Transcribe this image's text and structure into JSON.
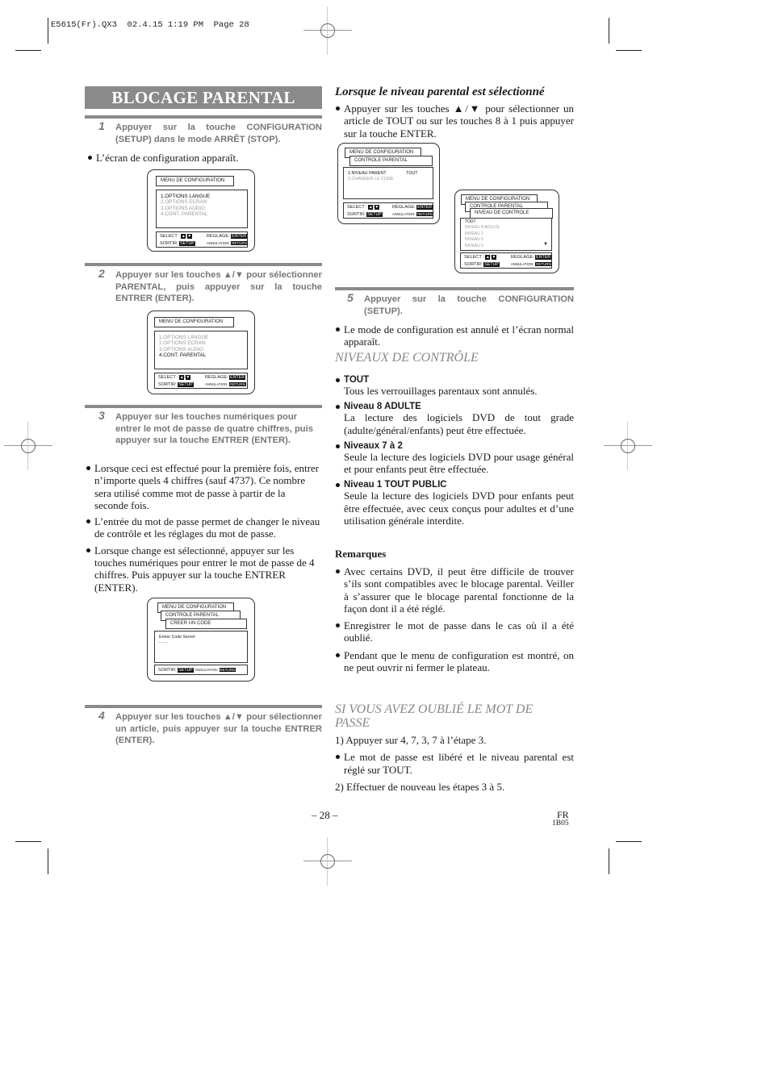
{
  "slug": "E5615(Fr).QX3  02.4.15 1:19 PM  Page 28",
  "title": "BLOCAGE PARENTAL",
  "left": {
    "step1": {
      "num": "1",
      "text": "Appuyer sur la touche CONFIGURATION (SETUP) dans le mode ARRÊT (STOP)."
    },
    "step1_bullet": "L’écran de configuration apparaît.",
    "screen1": {
      "header": "MENU DE CONFIGURATION",
      "items": [
        "1.OPTIONS LANGUE",
        "2.OPTIONS ECRAN",
        "3.OPTIONS AUDIO",
        "4.CONT. PARENTAL"
      ],
      "selected_index": 0
    },
    "step2": {
      "num": "2",
      "text": "Appuyer sur les touches ▲/▼ pour sélectionner PARENTAL, puis appuyer sur la touche ENTRER (ENTER)."
    },
    "screen2": {
      "header": "MENU DE CONFIGURATION",
      "items": [
        "1.OPTIONS LANGUE",
        "2.OPTIONS ECRAN",
        "3.OPTIONS AUDIO",
        "4.CONT. PARENTAL"
      ],
      "selected_index": 3
    },
    "step3": {
      "num": "3",
      "text": "Appuyer sur les touches numériques pour entrer le mot de passe de quatre chiffres, puis appuyer sur la touche ENTRER (ENTER)."
    },
    "step3_bullets": [
      "Lorsque ceci est effectué pour la première fois, entrer n’importe quels 4 chiffres (sauf 4737). Ce nombre sera utilisé comme mot de passe à partir de la seconde fois.",
      "L’entrée du mot de passe permet de changer le niveau de contrôle et les réglages du mot de passe.",
      "Lorsque change est sélectionné, appuyer sur les touches numériques pour entrer le mot de passe de 4 chiffres. Puis appuyer sur la touche ENTRER (ENTER)."
    ],
    "screen3": {
      "headers": [
        "MENU DE CONFIGURATION",
        "CONTROLE PARENTAL",
        "CREER UN CODE"
      ],
      "prompt": "Entrer Code Secret",
      "code": "- - - -"
    },
    "step4": {
      "num": "4",
      "text": "Appuyer sur les touches ▲/▼ pour sélectionner un article, puis appuyer sur la touche ENTRER (ENTER)."
    }
  },
  "controls": {
    "select_label": "SELECT :",
    "up": "▲",
    "down": "▼",
    "reglage_label": "RÉGLAGE:",
    "enter_key": "ENTER",
    "sortir_label": "SORTIR:",
    "setup_key": "SETUP",
    "annulation_label": "ANNULATION:",
    "return_key": "RETURN"
  },
  "right": {
    "heading": "Lorsque le niveau parental est sélectionné",
    "heading_bullet": "Appuyer sur les touches ▲/▼ pour sélectionner un article de TOUT ou sur les touches 8 à 1 puis appuyer sur la touche ENTER.",
    "screen4": {
      "headers": [
        "MENU DE CONFIGURATION",
        "CONTROLE PARENTAL"
      ],
      "items": [
        {
          "label": "1.NIVEAU PARENT",
          "value": "TOUT"
        },
        {
          "label": "2.CHANGER LE CODE",
          "value": ""
        }
      ]
    },
    "screen5": {
      "headers": [
        "MENU DE CONFIGURATION",
        "CONTROLE PARENTAL",
        "NIVEAU DE CONTROLE"
      ],
      "items": [
        "TOUT",
        "NIVEAU 8 ADULTE",
        "NIVEAU 7",
        "NIVEAU 6",
        "NIVEAU 5"
      ],
      "selected_index": 0,
      "more": "▼"
    },
    "step5": {
      "num": "5",
      "text": "Appuyer sur la touche CONFIGURATION (SETUP)."
    },
    "step5_bullet": "Le mode de configuration est annulé et l’écran normal apparaît.",
    "levels_heading": "NIVEAUX DE CONTRÔLE",
    "levels": [
      {
        "name": "TOUT",
        "desc": "Tous les verrouillages parentaux sont annulés."
      },
      {
        "name": "Niveau 8 ADULTE",
        "desc": "La lecture des logiciels DVD de tout grade (adulte/général/enfants) peut être effectuée."
      },
      {
        "name": "Niveaux 7 à 2",
        "desc": "Seule la lecture des logiciels DVD pour usage général et pour enfants peut être effectuée."
      },
      {
        "name": "Niveau 1 TOUT PUBLIC",
        "desc": "Seule la lecture des logiciels DVD pour enfants peut être effectuée, avec ceux conçus pour adultes et d’une utilisation générale interdite."
      }
    ],
    "remarks_heading": "Remarques",
    "remarks": [
      "Avec certains DVD, il peut être difficile de trouver s’ils sont compatibles avec le blocage parental. Veiller à s’assurer que le blocage parental fonctionne de la façon dont il a été réglé.",
      "Enregistrer le mot de passe dans le cas où il a été oublié.",
      "Pendant que le menu de configuration est montré, on ne peut ouvrir ni fermer le plateau."
    ],
    "forgot_heading": "SI VOUS AVEZ OUBLIÉ LE MOT DE PASSE",
    "forgot_step1": "1) Appuyer sur 4, 7, 3, 7 à l’étape 3.",
    "forgot_bullet": "Le mot de passe est libéré et le niveau parental est réglé sur TOUT.",
    "forgot_step2": "2) Effectuer de nouveau les étapes 3 à 5."
  },
  "footer": {
    "page": "– 28 –",
    "lang": "FR",
    "code": "1B05"
  }
}
